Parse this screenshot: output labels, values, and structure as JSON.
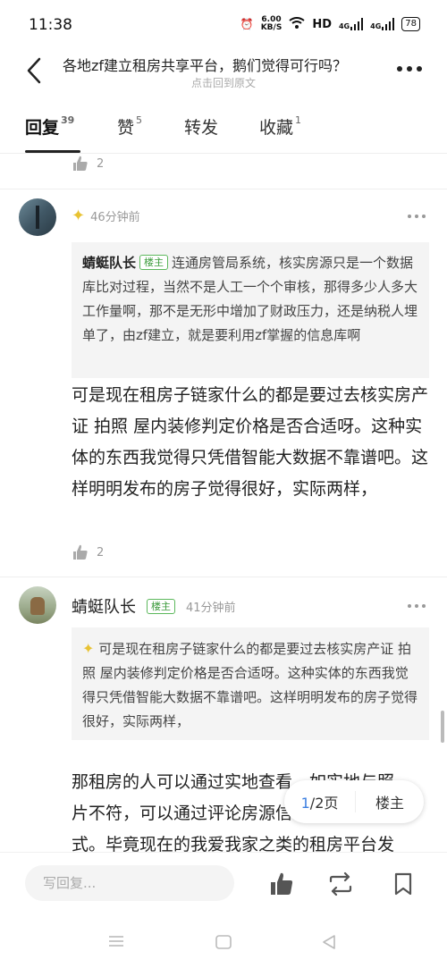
{
  "status_bar": {
    "time": "11:38",
    "net_speed_top": "6.00",
    "net_speed_bottom": "KB/S",
    "hd": "HD",
    "signal1": "4G",
    "signal2": "4G",
    "battery": "78"
  },
  "header": {
    "title": "各地zf建立租房共享平台，鹅们觉得可行吗？",
    "subtitle": "点击回到原文"
  },
  "tabs": [
    {
      "label": "回复",
      "count": "39"
    },
    {
      "label": "赞",
      "count": "5"
    },
    {
      "label": "转发",
      "count": ""
    },
    {
      "label": "收藏",
      "count": "1"
    }
  ],
  "top_like": {
    "count": "2"
  },
  "comment1": {
    "time": "46分钟前",
    "quote_author": "蜻蜓队长",
    "quote_badge": "楼主",
    "quote_text": "连通房管局系统，核实房源只是一个数据库比对过程，当然不是人工一个个审核，那得多少人多大工作量啊，那不是无形中增加了财政压力，还是纳税人埋单了，由zf建立，就是要利用zf掌握的信息库啊",
    "text": "可是现在租房子链家什么的都是要过去核实房产证 拍照 屋内装修判定价格是否合适呀。这种实体的东西我觉得只凭借智能大数据不靠谱吧。这样明明发布的房子觉得很好，实际两样，",
    "likes": "2"
  },
  "comment2": {
    "author": "蜻蜓队长",
    "badge": "楼主",
    "time": "41分钟前",
    "quote_text": "可是现在租房子链家什么的都是要过去核实房产证 拍照 屋内装修判定价格是否合适呀。这种实体的东西我觉得只凭借智能大数据不靠谱吧。这样明明发布的房子觉得很好，实际两样，",
    "text_line1": "那租房的人可以通过实地查看，如实地与照",
    "text_line2": "片不符，可以通过评论房源信息",
    "text_line3": "式。毕竟现在的我爱我家之类的租房平台发"
  },
  "pager": {
    "current": "1",
    "total": "/2页",
    "op_label": "楼主"
  },
  "bottom_bar": {
    "placeholder": "写回复..."
  },
  "colors": {
    "accent": "#3d7fe0",
    "badge_green": "#3a9a3a",
    "sparkle": "#e8c232"
  }
}
